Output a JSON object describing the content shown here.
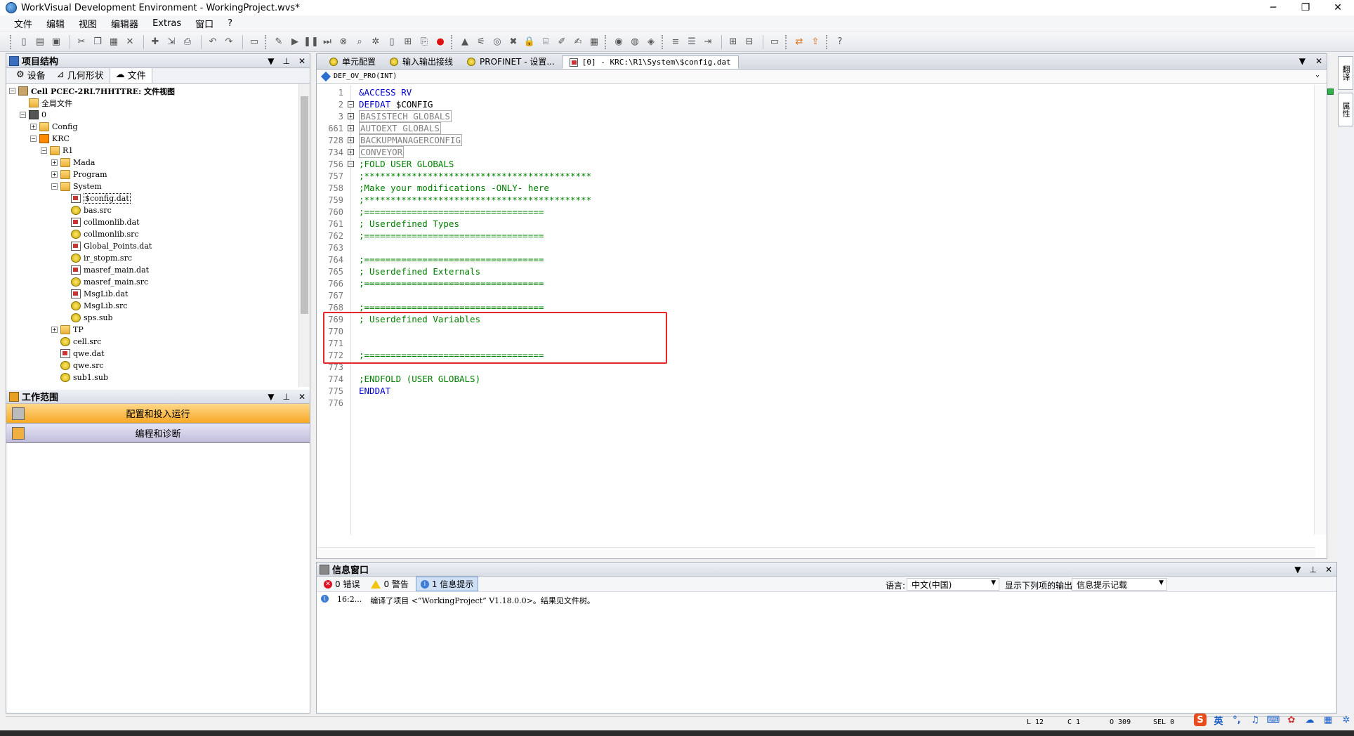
{
  "window": {
    "title": "WorkVisual Development Environment - WorkingProject.wvs*",
    "min_label": "─",
    "restore_label": "❐",
    "close_label": "✕"
  },
  "menu": [
    "文件",
    "编辑",
    "视图",
    "编辑器",
    "Extras",
    "窗口",
    "?"
  ],
  "left_panel": {
    "title": "项目结构",
    "tabs": [
      "设备",
      "几何形状",
      "文件"
    ],
    "tree": [
      {
        "label": "Cell PCEC-2RL7HHTTRE: 文件视图",
        "indent": 0,
        "exp": "−",
        "icon": "cell",
        "bold": true
      },
      {
        "label": "全局文件",
        "indent": 1,
        "exp": "",
        "icon": "global"
      },
      {
        "label": "0",
        "indent": 1,
        "exp": "−",
        "icon": "ctrl"
      },
      {
        "label": "Config",
        "indent": 2,
        "exp": "+",
        "icon": "folder"
      },
      {
        "label": "KRC",
        "indent": 2,
        "exp": "−",
        "icon": "robot"
      },
      {
        "label": "R1",
        "indent": 3,
        "exp": "−",
        "icon": "folder"
      },
      {
        "label": "Mada",
        "indent": 4,
        "exp": "+",
        "icon": "folder"
      },
      {
        "label": "Program",
        "indent": 4,
        "exp": "+",
        "icon": "folder"
      },
      {
        "label": "System",
        "indent": 4,
        "exp": "−",
        "icon": "folder"
      },
      {
        "label": "$config.dat",
        "indent": 5,
        "exp": "",
        "icon": "file",
        "selected": true
      },
      {
        "label": "bas.src",
        "indent": 5,
        "exp": "",
        "icon": "src"
      },
      {
        "label": "collmonlib.dat",
        "indent": 5,
        "exp": "",
        "icon": "file"
      },
      {
        "label": "collmonlib.src",
        "indent": 5,
        "exp": "",
        "icon": "src"
      },
      {
        "label": "Global_Points.dat",
        "indent": 5,
        "exp": "",
        "icon": "file"
      },
      {
        "label": "ir_stopm.src",
        "indent": 5,
        "exp": "",
        "icon": "src"
      },
      {
        "label": "masref_main.dat",
        "indent": 5,
        "exp": "",
        "icon": "file"
      },
      {
        "label": "masref_main.src",
        "indent": 5,
        "exp": "",
        "icon": "src"
      },
      {
        "label": "MsgLib.dat",
        "indent": 5,
        "exp": "",
        "icon": "file"
      },
      {
        "label": "MsgLib.src",
        "indent": 5,
        "exp": "",
        "icon": "src"
      },
      {
        "label": "sps.sub",
        "indent": 5,
        "exp": "",
        "icon": "src"
      },
      {
        "label": "TP",
        "indent": 4,
        "exp": "+",
        "icon": "folder"
      },
      {
        "label": "cell.src",
        "indent": 4,
        "exp": "",
        "icon": "src"
      },
      {
        "label": "qwe.dat",
        "indent": 4,
        "exp": "",
        "icon": "file"
      },
      {
        "label": "qwe.src",
        "indent": 4,
        "exp": "",
        "icon": "src"
      },
      {
        "label": "sub1.sub",
        "indent": 4,
        "exp": "",
        "icon": "src"
      }
    ]
  },
  "workscope": {
    "title": "工作范围",
    "buttons": [
      "配置和投入运行",
      "编程和诊断"
    ]
  },
  "editor": {
    "tabs": [
      {
        "label": "单元配置",
        "active": false
      },
      {
        "label": "输入输出接线",
        "active": false
      },
      {
        "label": "PROFINET - 设置...",
        "active": false
      },
      {
        "label": "[0] - KRC:\\R1\\System\\$config.dat",
        "active": true
      }
    ],
    "function_selector": "DEF_OV_PRO(INT)",
    "lines": [
      {
        "n": "1",
        "fold": "",
        "parts": [
          {
            "t": "&ACCESS RV",
            "c": "kw"
          }
        ]
      },
      {
        "n": "2",
        "fold": "−",
        "parts": [
          {
            "t": "DEFDAT ",
            "c": "kw"
          },
          {
            "t": "$CONFIG",
            "c": "plain"
          }
        ]
      },
      {
        "n": "3",
        "fold": "+",
        "parts": [
          {
            "t": "BASISTECH GLOBALS",
            "c": "folded"
          }
        ]
      },
      {
        "n": "661",
        "fold": "+",
        "parts": [
          {
            "t": "AUTOEXT GLOBALS",
            "c": "folded"
          }
        ]
      },
      {
        "n": "728",
        "fold": "+",
        "parts": [
          {
            "t": "BACKUPMANAGERCONFIG",
            "c": "folded"
          }
        ]
      },
      {
        "n": "734",
        "fold": "+",
        "parts": [
          {
            "t": "CONVEYOR",
            "c": "folded"
          }
        ]
      },
      {
        "n": "756",
        "fold": "−",
        "parts": [
          {
            "t": ";FOLD USER GLOBALS",
            "c": "cmt"
          }
        ]
      },
      {
        "n": "757",
        "fold": "",
        "parts": [
          {
            "t": ";*******************************************",
            "c": "cmt"
          }
        ]
      },
      {
        "n": "758",
        "fold": "",
        "parts": [
          {
            "t": ";Make your modifications -ONLY- here",
            "c": "cmt"
          }
        ]
      },
      {
        "n": "759",
        "fold": "",
        "parts": [
          {
            "t": ";*******************************************",
            "c": "cmt"
          }
        ]
      },
      {
        "n": "760",
        "fold": "",
        "parts": [
          {
            "t": ";==================================",
            "c": "cmt"
          }
        ]
      },
      {
        "n": "761",
        "fold": "",
        "parts": [
          {
            "t": "; Userdefined Types",
            "c": "cmt"
          }
        ]
      },
      {
        "n": "762",
        "fold": "",
        "parts": [
          {
            "t": ";==================================",
            "c": "cmt"
          }
        ]
      },
      {
        "n": "763",
        "fold": "",
        "parts": []
      },
      {
        "n": "764",
        "fold": "",
        "parts": [
          {
            "t": ";==================================",
            "c": "cmt"
          }
        ]
      },
      {
        "n": "765",
        "fold": "",
        "parts": [
          {
            "t": "; Userdefined Externals",
            "c": "cmt"
          }
        ]
      },
      {
        "n": "766",
        "fold": "",
        "parts": [
          {
            "t": ";==================================",
            "c": "cmt"
          }
        ]
      },
      {
        "n": "767",
        "fold": "",
        "parts": []
      },
      {
        "n": "768",
        "fold": "",
        "parts": [
          {
            "t": ";==================================",
            "c": "cmt"
          }
        ]
      },
      {
        "n": "769",
        "fold": "",
        "parts": [
          {
            "t": "; Userdefined Variables",
            "c": "cmt"
          }
        ]
      },
      {
        "n": "770",
        "fold": "",
        "parts": []
      },
      {
        "n": "771",
        "fold": "",
        "parts": []
      },
      {
        "n": "772",
        "fold": "",
        "parts": [
          {
            "t": ";==================================",
            "c": "cmt"
          }
        ]
      },
      {
        "n": "773",
        "fold": "",
        "parts": []
      },
      {
        "n": "774",
        "fold": "",
        "parts": [
          {
            "t": ";ENDFOLD (USER GLOBALS)",
            "c": "cmt"
          }
        ]
      },
      {
        "n": "775",
        "fold": "",
        "parts": [
          {
            "t": "ENDDAT",
            "c": "kw"
          }
        ]
      },
      {
        "n": "776",
        "fold": "",
        "parts": []
      }
    ]
  },
  "info_panel": {
    "title": "信息窗口",
    "errors": "0 错误",
    "warnings": "0 警告",
    "infos": "1 信息提示",
    "language_label": "语言:",
    "language_value": "中文(中国)",
    "output_label": "显示下列项的输出:",
    "output_value": "信息提示记载",
    "messages": [
      {
        "time": "16:2...",
        "text": "编译了项目 <“WorkingProject” V1.18.0.0>。结果见文件树。"
      }
    ]
  },
  "statusbar": {
    "line": "L 12",
    "col": "C 1",
    "offset": "O 309",
    "sel": "SEL 0"
  },
  "right_strip": [
    "翻译",
    "属性"
  ],
  "tray": {
    "ime_label": "英",
    "ime_punct": "°,"
  },
  "colors": {
    "keyword": "#0000cc",
    "comment": "#008000",
    "highlight_box": "#e8262a",
    "active_workscope": "#f7a926"
  }
}
